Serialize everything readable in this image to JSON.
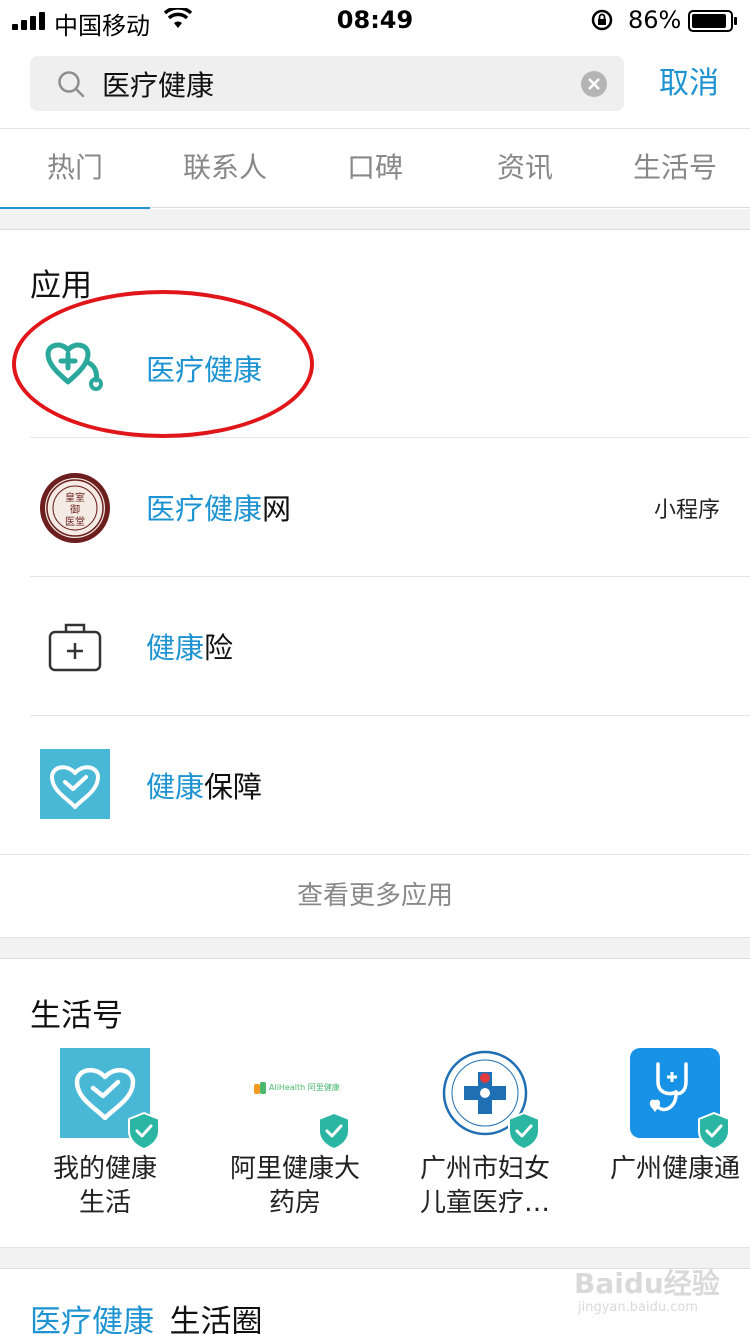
{
  "status_bar": {
    "carrier": "中国移动",
    "time": "08:49",
    "battery": "86%"
  },
  "search": {
    "query": "医疗健康",
    "cancel": "取消"
  },
  "tabs": [
    {
      "label": "热门",
      "active": true
    },
    {
      "label": "联系人"
    },
    {
      "label": "口碑"
    },
    {
      "label": "资讯"
    },
    {
      "label": "生活号"
    }
  ],
  "apps_section": {
    "title": "应用",
    "items": [
      {
        "highlight": "医疗健康",
        "rest": "",
        "tag": "",
        "icon": "stethoscope-icon"
      },
      {
        "highlight": "医疗健康",
        "rest": "网",
        "tag": "小程序",
        "icon": "seal-logo"
      },
      {
        "highlight": "健康",
        "rest": "险",
        "tag": "",
        "icon": "medical-kit-icon"
      },
      {
        "highlight": "健康",
        "rest": "保障",
        "tag": "",
        "icon": "heart-check-icon"
      }
    ],
    "more": "查看更多应用"
  },
  "life_section": {
    "title": "生活号",
    "items": [
      {
        "name": "我的健康\n生活",
        "icon": "heart-check-icon"
      },
      {
        "name": "阿里健康大\n药房",
        "icon": "alihealth-logo",
        "logo_text": "AliHealth 阿里健康大药房"
      },
      {
        "name": "广州市妇女\n儿童医疗…",
        "icon": "hospital-emblem-icon"
      },
      {
        "name": "广州健康通",
        "icon": "stethoscope-icon"
      }
    ]
  },
  "circle_section": {
    "highlight": "医疗健康",
    "rest": "_生活圈"
  },
  "watermark": {
    "text": "Baidu经验",
    "sub": "jingyan.baidu.com"
  },
  "colors": {
    "accent": "#1d93d2",
    "teal": "#2ba89c",
    "annotation": "#e0161b"
  }
}
